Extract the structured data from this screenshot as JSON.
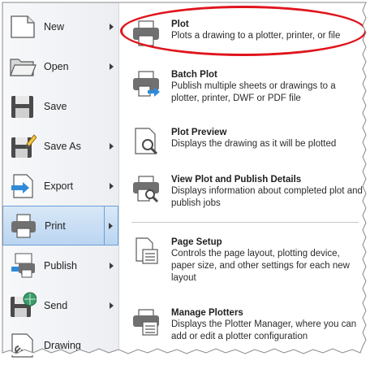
{
  "left_menu": {
    "items": [
      {
        "label": "New",
        "icon": "new-file-icon",
        "has_submenu": true
      },
      {
        "label": "Open",
        "icon": "open-folder-icon",
        "has_submenu": true
      },
      {
        "label": "Save",
        "icon": "save-icon",
        "has_submenu": false
      },
      {
        "label": "Save As",
        "icon": "save-as-icon",
        "has_submenu": true
      },
      {
        "label": "Export",
        "icon": "export-icon",
        "has_submenu": true
      },
      {
        "label": "Print",
        "icon": "print-icon",
        "has_submenu": true,
        "active": true
      },
      {
        "label": "Publish",
        "icon": "publish-icon",
        "has_submenu": true
      },
      {
        "label": "Send",
        "icon": "send-icon",
        "has_submenu": true
      },
      {
        "label": "Drawing",
        "icon": "drawing-utilities-icon",
        "has_submenu": false
      }
    ]
  },
  "submenu": {
    "items": [
      {
        "title": "Plot",
        "description": "Plots a drawing to a plotter, printer, or file",
        "icon": "plot-icon"
      },
      {
        "title": "Batch Plot",
        "description": "Publish multiple sheets or drawings to a plotter, printer, DWF or PDF file",
        "icon": "batch-plot-icon"
      },
      {
        "title": "Plot Preview",
        "description": "Displays the drawing as it will be plotted",
        "icon": "plot-preview-icon"
      },
      {
        "title": "View Plot and Publish Details",
        "description": "Displays information about completed plot and publish jobs",
        "icon": "plot-details-icon"
      },
      {
        "title": "Page Setup",
        "description": "Controls the page layout, plotting device, paper size, and other settings for each new layout",
        "icon": "page-setup-icon"
      },
      {
        "title": "Manage Plotters",
        "description": "Displays the Plotter Manager, where you can add or edit a plotter configuration",
        "icon": "manage-plotters-icon"
      }
    ]
  },
  "colors": {
    "highlight": "#e0141c",
    "active_bg": "#c7dcf3",
    "active_border": "#6b9fd6"
  }
}
